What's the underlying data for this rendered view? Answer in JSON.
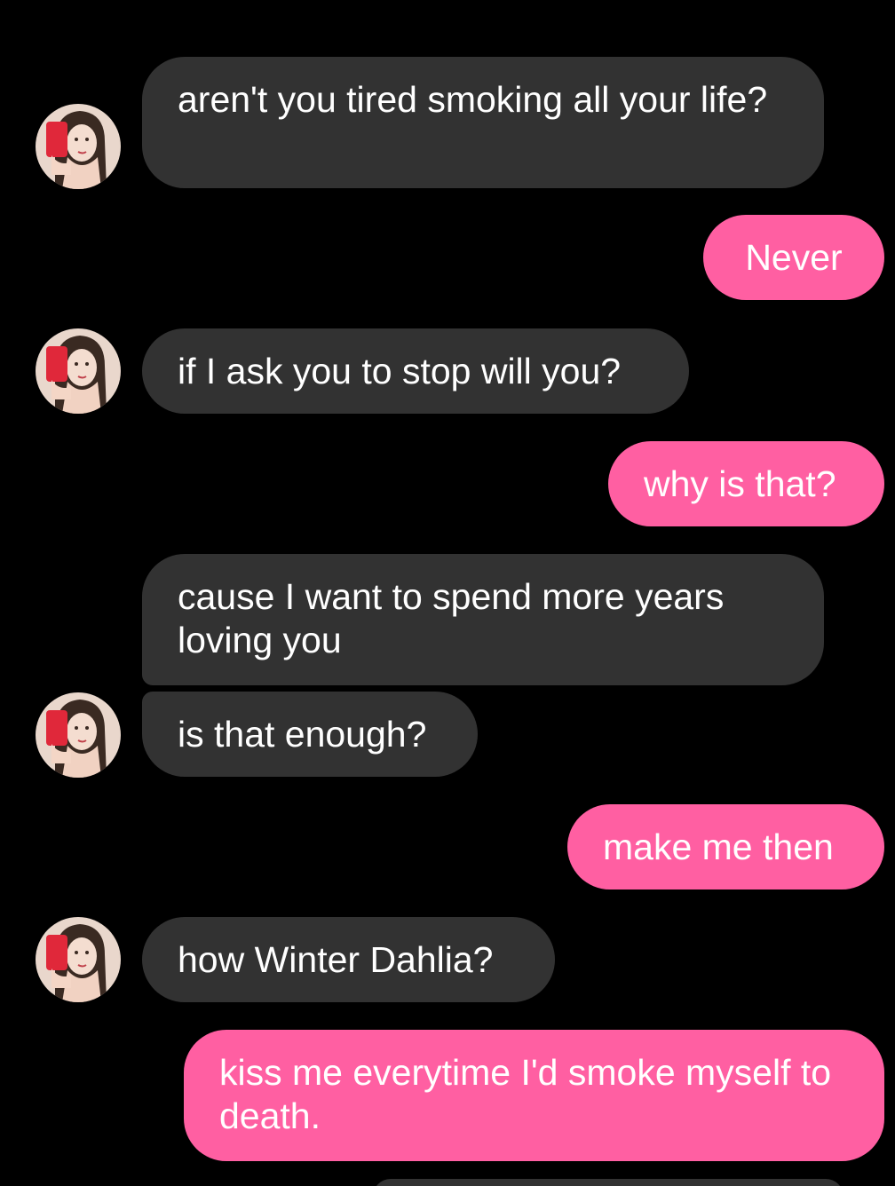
{
  "chat": {
    "messages": [
      {
        "side": "incoming",
        "text": "aren't you tired smoking all your life?"
      },
      {
        "side": "outgoing",
        "text": "Never"
      },
      {
        "side": "incoming",
        "text": "if I ask you to stop will you?"
      },
      {
        "side": "outgoing",
        "text": "why is that?"
      },
      {
        "side": "incoming",
        "text": "cause I want to spend more years loving you"
      },
      {
        "side": "incoming",
        "text": "is that enough?"
      },
      {
        "side": "outgoing",
        "text": "make me then"
      },
      {
        "side": "incoming",
        "text": "how Winter Dahlia?"
      },
      {
        "side": "outgoing",
        "text": "kiss me everytime I'd smoke myself to death."
      }
    ]
  },
  "colors": {
    "background": "#000000",
    "incoming_bubble": "#323232",
    "outgoing_bubble": "#ff5fa2",
    "text": "#ffffff"
  },
  "icons": {
    "avatar": "contact-avatar-photo"
  }
}
